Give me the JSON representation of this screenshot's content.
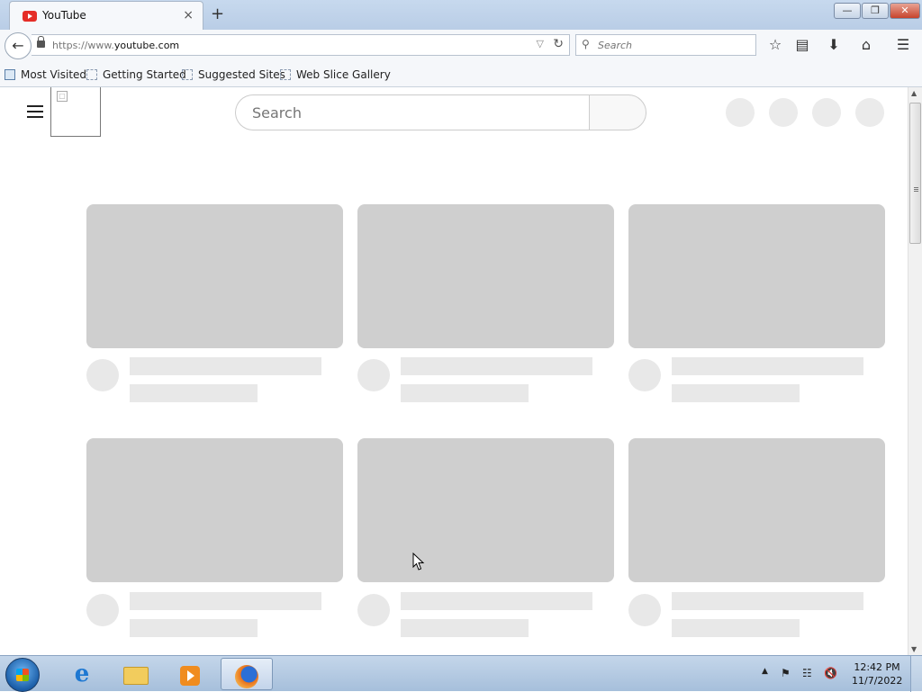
{
  "tab": {
    "title": "YouTube",
    "close_symbol": "×",
    "newtab_symbol": "+"
  },
  "window_controls": {
    "minimize": "—",
    "maximize": "❐",
    "close": "✕"
  },
  "navbar": {
    "url_prefix": "https://www.",
    "url_domain": "youtube.com",
    "search_placeholder": "Search",
    "icons": [
      "back-arrow-icon",
      "lock-icon",
      "dropdown-icon",
      "reload-icon",
      "search-icon",
      "bookmark-star-icon",
      "reading-list-icon",
      "download-icon",
      "home-icon",
      "menu-icon"
    ]
  },
  "bookmarks": [
    {
      "label": "Most Visited"
    },
    {
      "label": "Getting Started"
    },
    {
      "label": "Suggested Sites"
    },
    {
      "label": "Web Slice Gallery"
    }
  ],
  "youtube": {
    "search_placeholder": "Search",
    "placeholder_color": "#cfcfcf",
    "skeleton_color": "#e8e8e8"
  },
  "taskbar": {
    "apps": [
      "internet-explorer-icon",
      "windows-explorer-icon",
      "media-player-icon",
      "firefox-icon"
    ],
    "active_app": "firefox",
    "clock": {
      "time": "12:42 PM",
      "date": "11/7/2022"
    },
    "tray_icons": [
      "show-hidden-icons-icon",
      "action-center-flag-icon",
      "network-icon",
      "volume-muted-icon"
    ]
  },
  "colors": {
    "titlebar": "#c7d9ee",
    "brand_red": "#e52d27",
    "taskbar": "#b5cbe3"
  }
}
